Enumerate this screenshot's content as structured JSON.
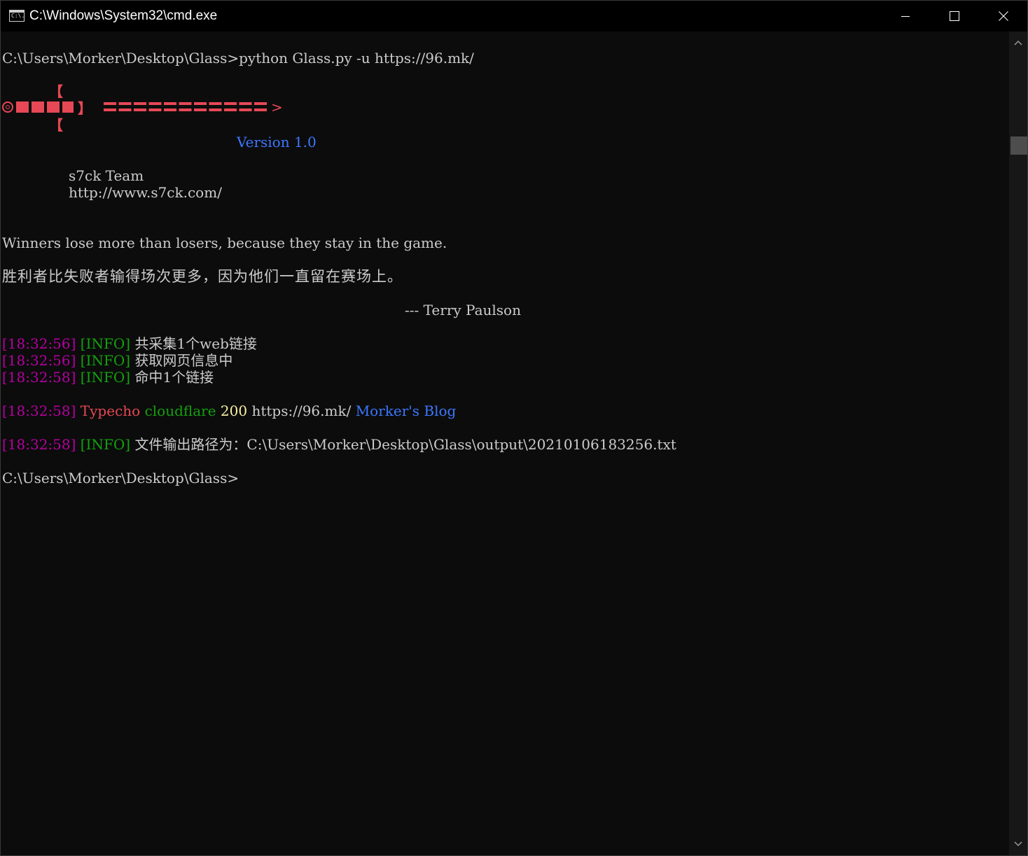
{
  "window": {
    "title": "C:\\Windows\\System32\\cmd.exe",
    "icon_text": "C:\\."
  },
  "console": {
    "command_line": {
      "prompt": "C:\\Users\\Morker\\Desktop\\Glass>",
      "command": "python Glass.py -u https://96.mk/"
    },
    "banner": {
      "top_bracket": "【",
      "bottom_bracket": "【",
      "close_bracket": "】",
      "tip": ">"
    },
    "version": "Version 1.0",
    "team": "s7ck Team",
    "team_url": "http://www.s7ck.com/",
    "quote_en": "Winners lose more than losers, because they stay in the game.",
    "quote_zh": "胜利者比失败者输得场次更多，因为他们一直留在赛场上。",
    "quote_author": "--- Terry Paulson",
    "logs": [
      {
        "time": "[18:32:56]",
        "level": "[INFO]",
        "message": "共采集1个web链接"
      },
      {
        "time": "[18:32:56]",
        "level": "[INFO]",
        "message": "获取网页信息中"
      },
      {
        "time": "[18:32:58]",
        "level": "[INFO]",
        "message": "命中1个链接"
      }
    ],
    "result": {
      "time": "[18:32:58]",
      "cms": "Typecho",
      "waf": "cloudflare",
      "status": "200",
      "url": "https://96.mk/",
      "title": "Morker's Blog"
    },
    "output_log": {
      "time": "[18:32:58]",
      "level": "[INFO]",
      "message": "文件输出路径为：C:\\Users\\Morker\\Desktop\\Glass\\output\\20210106183256.txt"
    },
    "final_prompt": "C:\\Users\\Morker\\Desktop\\Glass>"
  },
  "colors": {
    "background": "#0c0c0c",
    "text": "#cccccc",
    "red": "#e74856",
    "blue": "#3b78ff",
    "magenta": "#b4009e",
    "green": "#13a10e",
    "yellow": "#f9f1a5"
  }
}
